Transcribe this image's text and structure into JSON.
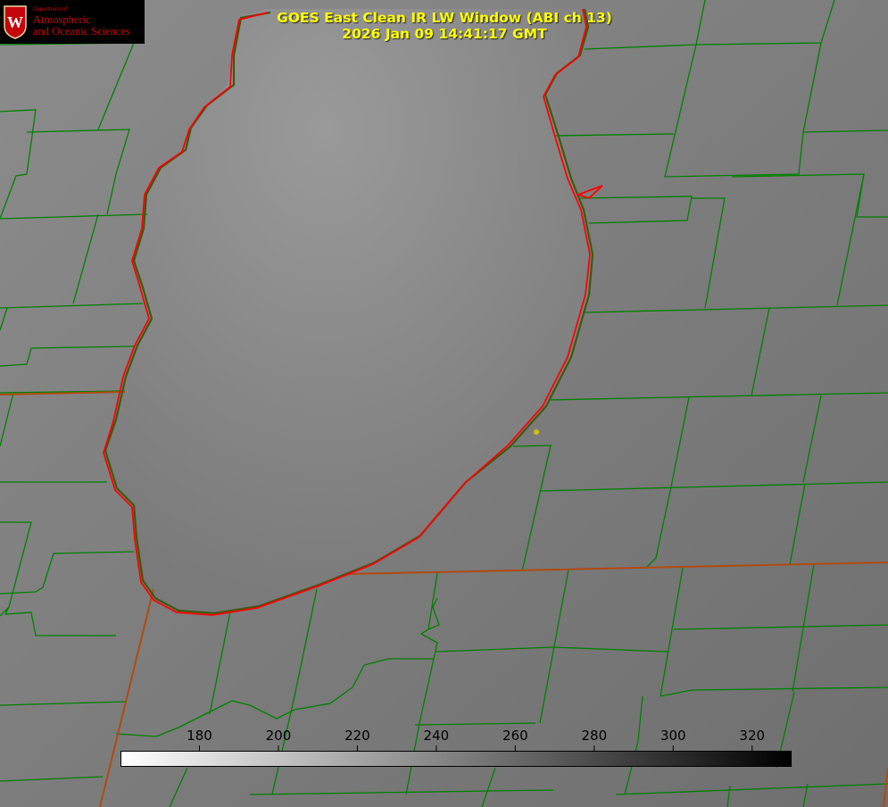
{
  "title_line1": "GOES East Clean IR LW Window (ABI ch 13)",
  "title_line2": "2026 Jan 09 14:41:17 GMT",
  "logo": {
    "dept": "Department of",
    "line1": "Atmospheric",
    "line2": "and Oceanic Sciences",
    "crest_letter": "W",
    "brand_color": "#c5050c",
    "icon": "uw-crest-icon"
  },
  "colorbar": {
    "min": 160,
    "max": 330,
    "ticks": [
      "180",
      "200",
      "220",
      "240",
      "260",
      "280",
      "300",
      "320"
    ],
    "tick_values": [
      180,
      200,
      220,
      240,
      260,
      280,
      300,
      320
    ],
    "colors": [
      "#ffffff",
      "#000000"
    ]
  },
  "colors": {
    "title": "#ffff00",
    "county_lines": "#008000",
    "shoreline": "#ff0000",
    "marker": "#d4c000"
  }
}
